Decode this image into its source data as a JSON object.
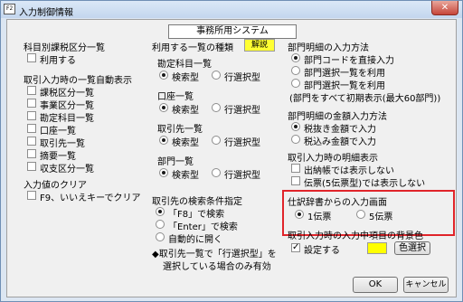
{
  "window": {
    "title": "入力制御情報",
    "app_icon_label": "F2",
    "close_label": "✕"
  },
  "system_title": "事務所用システム",
  "left": {
    "kamoku_heading": "科目別課税区分一覧",
    "use_label": "利用する",
    "auto_display_heading": "取引入力時の一覧自動表示",
    "auto_items": [
      "課税区分一覧",
      "事業区分一覧",
      "勘定科目一覧",
      "口座一覧",
      "取引先一覧",
      "摘要一覧",
      "収支区分一覧"
    ],
    "clear_heading": "入力値のクリア",
    "clear_label": "F9、いいえキーでクリア"
  },
  "middle": {
    "list_type_heading": "利用する一覧の種類",
    "kaisetsu_label": "解説",
    "groups": [
      {
        "title": "勘定科目一覧",
        "search_label": "検索型",
        "select_label": "行選択型"
      },
      {
        "title": "口座一覧",
        "search_label": "検索型",
        "select_label": "行選択型"
      },
      {
        "title": "取引先一覧",
        "search_label": "検索型",
        "select_label": "行選択型"
      },
      {
        "title": "部門一覧",
        "search_label": "検索型",
        "select_label": "行選択型"
      }
    ],
    "search_cond_heading": "取引先の検索条件指定",
    "search_options": [
      "「F8」で検索",
      "「Enter」で検索",
      "自動的に開く"
    ],
    "note_lines": [
      "◆取引先一覧で「行選択型」を",
      "選択している場合のみ有効"
    ]
  },
  "right": {
    "dept_heading": "部門明細の入力方法",
    "dept_options": [
      "部門コードを直接入力",
      "部門選択一覧を利用",
      "部門選択一覧を利用"
    ],
    "dept_note": "(部門をすべて初期表示(最大60部門))",
    "amount_heading": "部門明細の金額入力方法",
    "amount_options": [
      "税抜き金額で入力",
      "税込み金額で入力"
    ],
    "detail_heading": "取引入力時の明細表示",
    "detail_options": [
      "出納帳では表示しない",
      "伝票(5伝票型)では表示しない"
    ],
    "shiwake_heading": "仕訳辞書からの入力画面",
    "shiwake_options": [
      "1伝票",
      "5伝票"
    ],
    "bgcolor_heading": "取引入力時の入力中項目の背景色",
    "bgcolor_setting_label": "設定する",
    "bgcolor_color": "#ffff00",
    "color_select_label": "色選択"
  },
  "buttons": {
    "ok": "OK",
    "cancel": "キャンセル"
  }
}
